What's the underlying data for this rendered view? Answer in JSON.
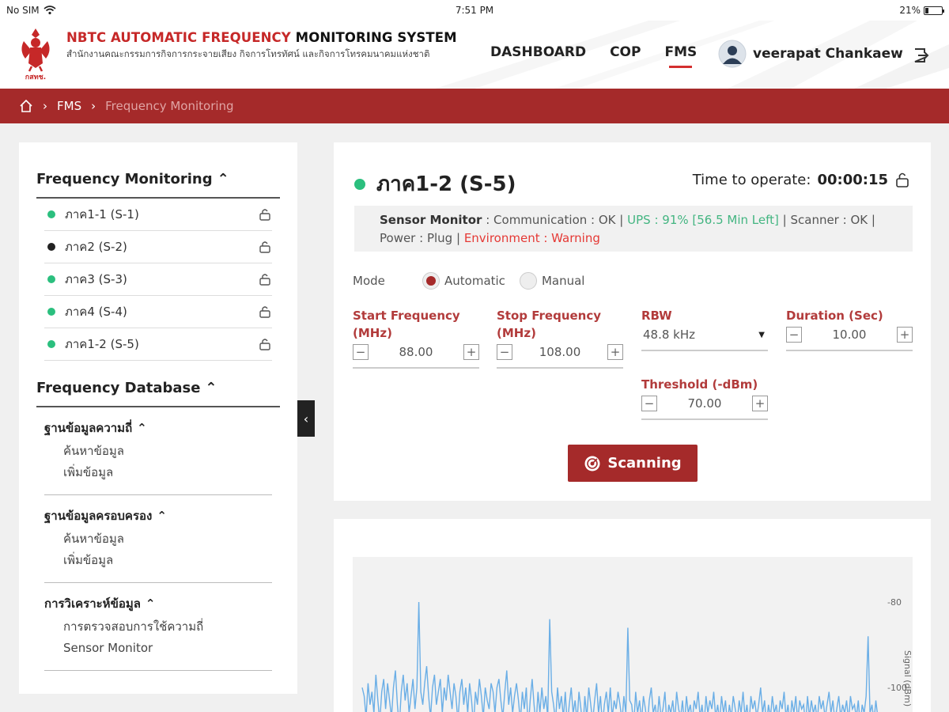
{
  "status_bar": {
    "carrier": "No SIM",
    "time": "7:51 PM",
    "battery": "21%",
    "battery_level": 0.21
  },
  "header": {
    "title_red": "NBTC AUTOMATIC FREQUENCY",
    "title_black": "MONITORING SYSTEM",
    "subtitle": "สำนักงานคณะกรรมการกิจการกระจายเสียง กิจการโทรทัศน์ และกิจการโทรคมนาคมแห่งชาติ",
    "logo_text": "กสทช.",
    "nav": [
      {
        "label": "DASHBOARD",
        "active": false
      },
      {
        "label": "COP",
        "active": false
      },
      {
        "label": "FMS",
        "active": true
      }
    ],
    "user": "veerapat Chankaew"
  },
  "breadcrumb": {
    "items": [
      "FMS",
      "Frequency Monitoring"
    ]
  },
  "sidebar": {
    "monitoring_title": "Frequency Monitoring",
    "stations": [
      {
        "label": "ภาค1-1 (S-1)",
        "color": "#2bbf7e"
      },
      {
        "label": "ภาค2 (S-2)",
        "color": "#222222"
      },
      {
        "label": "ภาค3 (S-3)",
        "color": "#2bbf7e"
      },
      {
        "label": "ภาค4 (S-4)",
        "color": "#2bbf7e"
      },
      {
        "label": "ภาค1-2 (S-5)",
        "color": "#2bbf7e"
      }
    ],
    "database_title": "Frequency Database",
    "groups": [
      {
        "title": "ฐานข้อมูลความถี่",
        "links": [
          "ค้นหาข้อมูล",
          "เพิ่มข้อมูล"
        ]
      },
      {
        "title": "ฐานข้อมูลครอบครอง",
        "links": [
          "ค้นหาข้อมูล",
          "เพิ่มข้อมูล"
        ]
      },
      {
        "title": "การวิเคราะห์ข้อมูล",
        "links": [
          "การตรวจสอบการใช้ความถี่",
          "Sensor Monitor"
        ]
      }
    ]
  },
  "panel": {
    "station_title": "ภาค1-2 (S-5)",
    "status_color": "#2bbf7e",
    "time_label": "Time to operate:",
    "time_value": "00:00:15",
    "sensor": {
      "label": "Sensor Monitor",
      "communication": ": Communication : OK",
      "ups": "UPS : 91% [56.5 Min Left]",
      "scanner": "Scanner",
      "scanner_value": ": OK",
      "power": "Power : Plug",
      "environment": "Environment : Warning"
    },
    "mode_label": "Mode",
    "mode_options": [
      "Automatic",
      "Manual"
    ],
    "mode_selected": "Automatic",
    "start_freq": {
      "label": "Start Frequency (MHz)",
      "value": "88.00"
    },
    "stop_freq": {
      "label": "Stop Frequency (MHz)",
      "value": "108.00"
    },
    "rbw": {
      "label": "RBW",
      "value": "48.8 kHz"
    },
    "duration": {
      "label": "Duration (Sec)",
      "value": "10.00"
    },
    "threshold": {
      "label": "Threshold (-dBm)",
      "value": "70.00"
    },
    "scan_button": "Scanning"
  },
  "chart_data": {
    "type": "line",
    "ylabel": "Signal (dBm)",
    "yticks": [
      "-80",
      "-100"
    ],
    "ylim": [
      -112,
      -75
    ],
    "series": [
      {
        "values": [
          -100,
          -102,
          -107,
          -99,
          -104,
          -101,
          -106,
          -97,
          -103,
          -108,
          -101,
          -98,
          -105,
          -99,
          -103,
          -107,
          -100,
          -96,
          -104,
          -109,
          -101,
          -97,
          -103,
          -99,
          -106,
          -102,
          -98,
          -105,
          -100,
          -80,
          -101,
          -104,
          -99,
          -95,
          -102,
          -107,
          -100,
          -97,
          -104,
          -101,
          -98,
          -106,
          -100,
          -103,
          -97,
          -101,
          -105,
          -99,
          -102,
          -108,
          -101,
          -98,
          -104,
          -100,
          -106,
          -99,
          -103,
          -109,
          -101,
          -104,
          -98,
          -102,
          -107,
          -100,
          -103,
          -105,
          -99,
          -101,
          -106,
          -100,
          -98,
          -103,
          -107,
          -101,
          -96,
          -104,
          -100,
          -106,
          -102,
          -99,
          -103,
          -108,
          -101,
          -105,
          -100,
          -110,
          -103,
          -98,
          -104,
          -109,
          -101,
          -106,
          -100,
          -105,
          -102,
          -107,
          -84,
          -101,
          -104,
          -108,
          -100,
          -105,
          -102,
          -107,
          -101,
          -109,
          -104,
          -100,
          -106,
          -103,
          -108,
          -101,
          -105,
          -110,
          -102,
          -107,
          -100,
          -104,
          -108,
          -103,
          -99,
          -106,
          -102,
          -109,
          -104,
          -101,
          -106,
          -100,
          -107,
          -103,
          -105,
          -101,
          -104,
          -108,
          -102,
          -106,
          -86,
          -103,
          -104,
          -109,
          -101,
          -106,
          -103,
          -108,
          -102,
          -105,
          -109,
          -103,
          -100,
          -106,
          -104,
          -108,
          -102,
          -107,
          -105,
          -101,
          -109,
          -104,
          -106,
          -103,
          -108,
          -101,
          -105,
          -107,
          -103,
          -109,
          -102,
          -106,
          -104,
          -108,
          -103,
          -105,
          -101,
          -107,
          -104,
          -109,
          -102,
          -106,
          -103,
          -105,
          -101,
          -107,
          -104,
          -108,
          -102,
          -106,
          -103,
          -109,
          -104,
          -107,
          -102,
          -105,
          -108,
          -103,
          -106,
          -101,
          -107,
          -104,
          -109,
          -102,
          -105,
          -103,
          -107,
          -104,
          -100,
          -106,
          -103,
          -109,
          -104,
          -107,
          -102,
          -106,
          -104,
          -108,
          -103,
          -105,
          -101,
          -107,
          -104,
          -109,
          -103,
          -106,
          -102,
          -108,
          -103,
          -105,
          -104,
          -109,
          -102,
          -107,
          -103,
          -106,
          -104,
          -108,
          -102,
          -105,
          -103,
          -107,
          -104,
          -101,
          -106,
          -103,
          -108,
          -105,
          -102,
          -107,
          -104,
          -106,
          -103,
          -108,
          -102,
          -105,
          -104,
          -107,
          -103,
          -109,
          -104,
          -106,
          -102,
          -88,
          -106,
          -104,
          -108,
          -103,
          -107
        ]
      }
    ]
  }
}
